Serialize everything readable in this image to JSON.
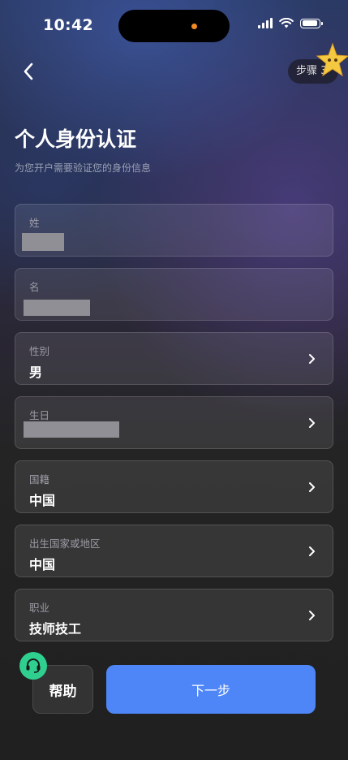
{
  "status_bar": {
    "time": "10:42"
  },
  "header": {
    "step_badge": "步骤 3"
  },
  "page": {
    "title": "个人身份认证",
    "subtitle": "为您开户需要验证您的身份信息"
  },
  "fields": {
    "last_name": {
      "label": "姓",
      "value": ""
    },
    "first_name": {
      "label": "名",
      "value": ""
    },
    "gender": {
      "label": "性别",
      "value": "男"
    },
    "birthday": {
      "label": "生日",
      "value": ""
    },
    "nationality": {
      "label": "国籍",
      "value": "中国"
    },
    "birth_country": {
      "label": "出生国家或地区",
      "value": "中国"
    },
    "occupation": {
      "label": "职业",
      "value": "技师技工"
    }
  },
  "actions": {
    "help_label": "帮助",
    "next_label": "下一步"
  },
  "colors": {
    "accent": "#4e86f8",
    "help_icon": "#2fd08f",
    "island_dot": "#f08a24"
  }
}
